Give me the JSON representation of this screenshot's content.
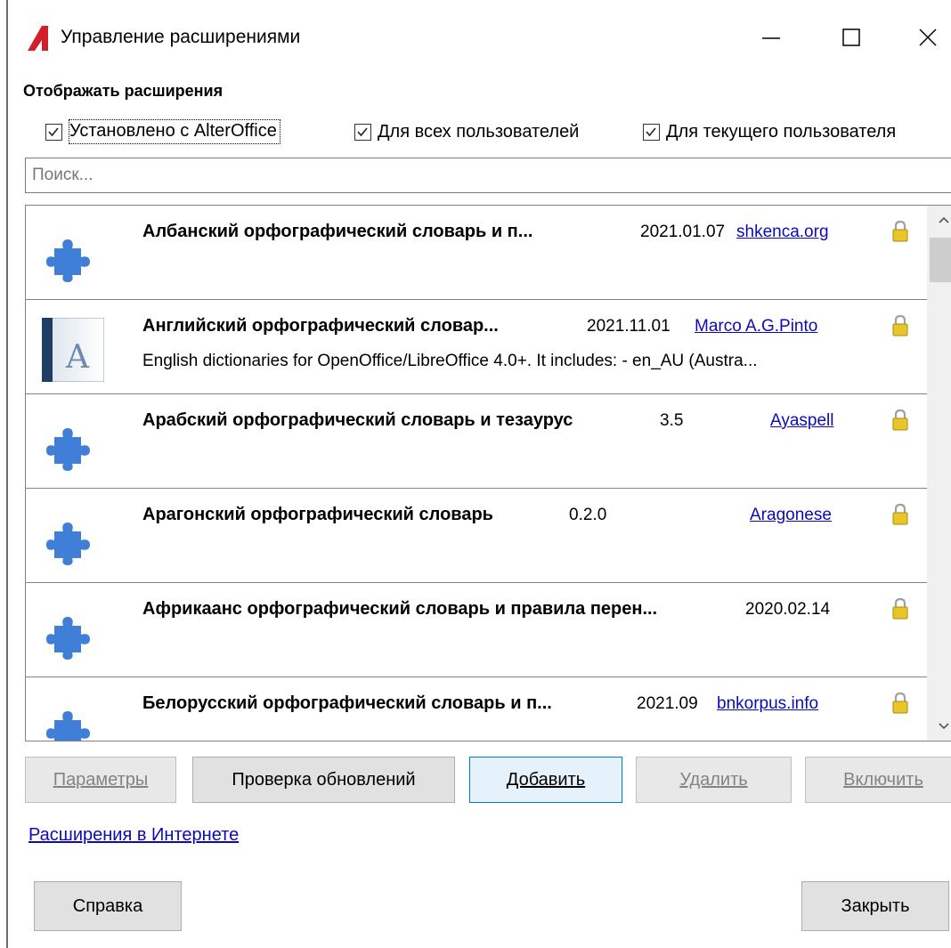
{
  "window": {
    "title": "Управление расширениями",
    "controls": {
      "minimize": "—",
      "maximize": "☐",
      "close": "✕"
    }
  },
  "filters": {
    "heading": "Отображать расширения",
    "items": [
      {
        "label": "Установлено с AlterOffice",
        "checked": true
      },
      {
        "label": "Для всех пользователей",
        "checked": true
      },
      {
        "label": "Для текущего пользователя",
        "checked": true
      }
    ]
  },
  "search": {
    "placeholder": "Поиск...",
    "value": ""
  },
  "extensions": [
    {
      "name": "Албанский орфографический словарь и п...",
      "version": "2021.01.07",
      "publisher": "shkenca.org",
      "description": "",
      "icon": "puzzle-icon",
      "locked": true
    },
    {
      "name": "Английский орфографический словар...",
      "version": "2021.11.01",
      "publisher": "Marco A.G.Pinto",
      "description": "English dictionaries for OpenOffice/LibreOffice 4.0+.  It includes: - en_AU (Austra...",
      "icon": "dictionary-icon",
      "locked": true
    },
    {
      "name": "Арабский орфографический словарь и тезаурус",
      "version": "3.5",
      "publisher": "Ayaspell",
      "description": "",
      "icon": "puzzle-icon",
      "locked": true
    },
    {
      "name": "Арагонский орфографический словарь",
      "version": "0.2.0",
      "publisher": "Aragonese",
      "description": "",
      "icon": "puzzle-icon",
      "locked": true
    },
    {
      "name": "Африкаанс орфографический словарь и правила перен...",
      "version": "2020.02.14",
      "publisher": "",
      "description": "",
      "icon": "puzzle-icon",
      "locked": true
    },
    {
      "name": "Белорусский орфографический словарь и п...",
      "version": "2021.09",
      "publisher": "bnkorpus.info",
      "description": "",
      "icon": "puzzle-icon",
      "locked": true
    }
  ],
  "actions": {
    "options": "Параметры",
    "check_updates": "Проверка обновлений",
    "add": "Добавить",
    "remove": "Удалить",
    "enable": "Включить"
  },
  "online_link": "Расширения в Интернете",
  "footer": {
    "help": "Справка",
    "close": "Закрыть"
  },
  "colors": {
    "link": "#0b0bb5",
    "puzzle": "#3f7fd8",
    "logo": "#d2202a",
    "primary_border": "#0078d7"
  }
}
